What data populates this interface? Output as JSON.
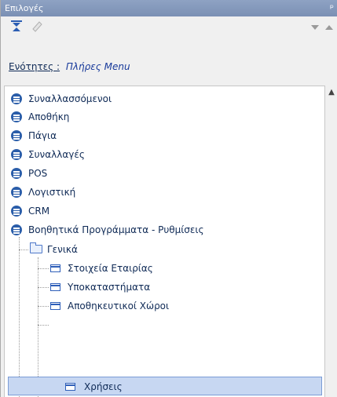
{
  "panel": {
    "title": "Επιλογές",
    "pin_glyph": "ᵖ"
  },
  "toolbar": {
    "collapse_icon": "collapse-all-icon",
    "eraser_icon": "eraser-icon",
    "down_icon": "triangle-down-icon",
    "up_icon": "triangle-up-icon"
  },
  "sections": {
    "label": "Ενότητες :",
    "value": "Πλήρες Menu"
  },
  "tree": {
    "top_items": [
      {
        "label": "Συναλλασσόμενοι"
      },
      {
        "label": "Αποθήκη"
      },
      {
        "label": "Πάγια"
      },
      {
        "label": "Συναλλαγές"
      },
      {
        "label": "POS"
      },
      {
        "label": "Λογιστική"
      },
      {
        "label": "CRM"
      },
      {
        "label": "Βοηθητικά Προγράμματα - Ρυθμίσεις"
      }
    ],
    "folder": {
      "label": "Γενικά"
    },
    "sub_items": [
      {
        "label": "Στοιχεία Εταιρίας"
      },
      {
        "label": "Υποκαταστήματα"
      },
      {
        "label": "Αποθηκευτικοί Χώροι"
      },
      {
        "label": "Χρήσεις"
      }
    ],
    "selected_item": "Χρήσεις"
  },
  "colors": {
    "titlebar": "#8ea2c3",
    "menu_icon": "#2a5da9",
    "selection": "#c7d7f2",
    "text": "#0f2a56"
  }
}
